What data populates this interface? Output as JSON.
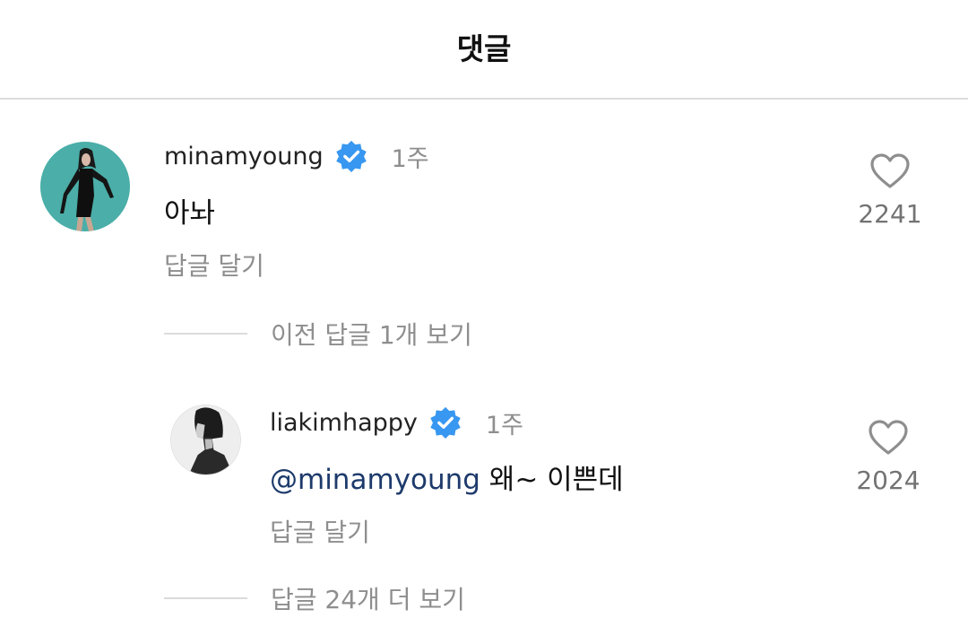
{
  "header": {
    "title": "댓글"
  },
  "comments": [
    {
      "username": "minamyoung",
      "time": "1주",
      "text": "아놔",
      "like_count": "2241",
      "reply_label": "답글 달기",
      "avatar_icon": "profile-photo-minamyoung"
    }
  ],
  "view_previous": "이전 답글 1개 보기",
  "reply": {
    "username": "liakimhappy",
    "time": "1주",
    "mention": "@minamyoung",
    "text": "왜~ 이쁜데",
    "like_count": "2024",
    "reply_label": "답글 달기",
    "avatar_icon": "profile-photo-liakimhappy"
  },
  "view_more": "답글 24개 더 보기",
  "colors": {
    "verified_badge": "#3897f0",
    "mention": "#1d3a6b",
    "secondary_text": "#8e8e8e",
    "divider": "#dbdbdb"
  }
}
